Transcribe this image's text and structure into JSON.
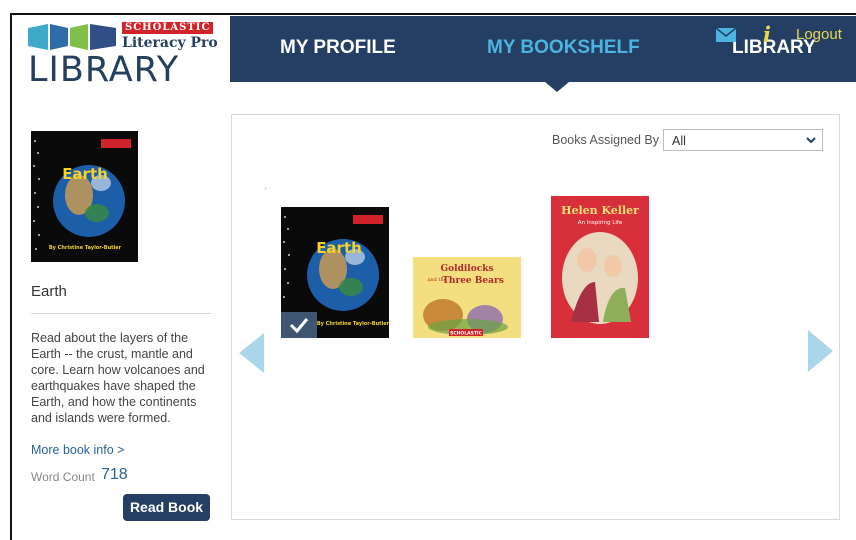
{
  "brand": {
    "badge": "SCHOLASTIC",
    "subtitle": "Literacy Pro",
    "title": "LIBRARY"
  },
  "nav": {
    "items": [
      {
        "label": "MY PROFILE",
        "active": false
      },
      {
        "label": "MY BOOKSHELF",
        "active": true
      },
      {
        "label": "LIBRARY",
        "active": false
      }
    ],
    "logout_label": "Logout",
    "info_label": "i",
    "accent_color": "#243f63",
    "active_color": "#4bb4e0",
    "utility_color": "#e9d94a"
  },
  "selected_book": {
    "title": "Earth",
    "description": "Read about the layers of the Earth -- the crust, mantle and core. Learn how volcanoes and earthquakes have shaped the Earth, and how the continents and islands were formed.",
    "more_info_label": "More book info >",
    "word_count_label": "Word Count",
    "word_count_value": "718",
    "read_button_label": "Read Book"
  },
  "shelf": {
    "filter_label": "Books Assigned By",
    "filter_value": "All",
    "books": [
      {
        "title": "Earth",
        "author": "By Christine Taylor-Butler",
        "series": "Rookie Read-About Science",
        "selected": true
      },
      {
        "title_line1": "Goldilocks",
        "title_connector": "and the",
        "title_line2": "Three Bears",
        "publisher": "SCHOLASTIC",
        "selected": false
      },
      {
        "title": "Helen Keller",
        "subtitle": "An Inspiring Life",
        "selected": false
      }
    ]
  }
}
